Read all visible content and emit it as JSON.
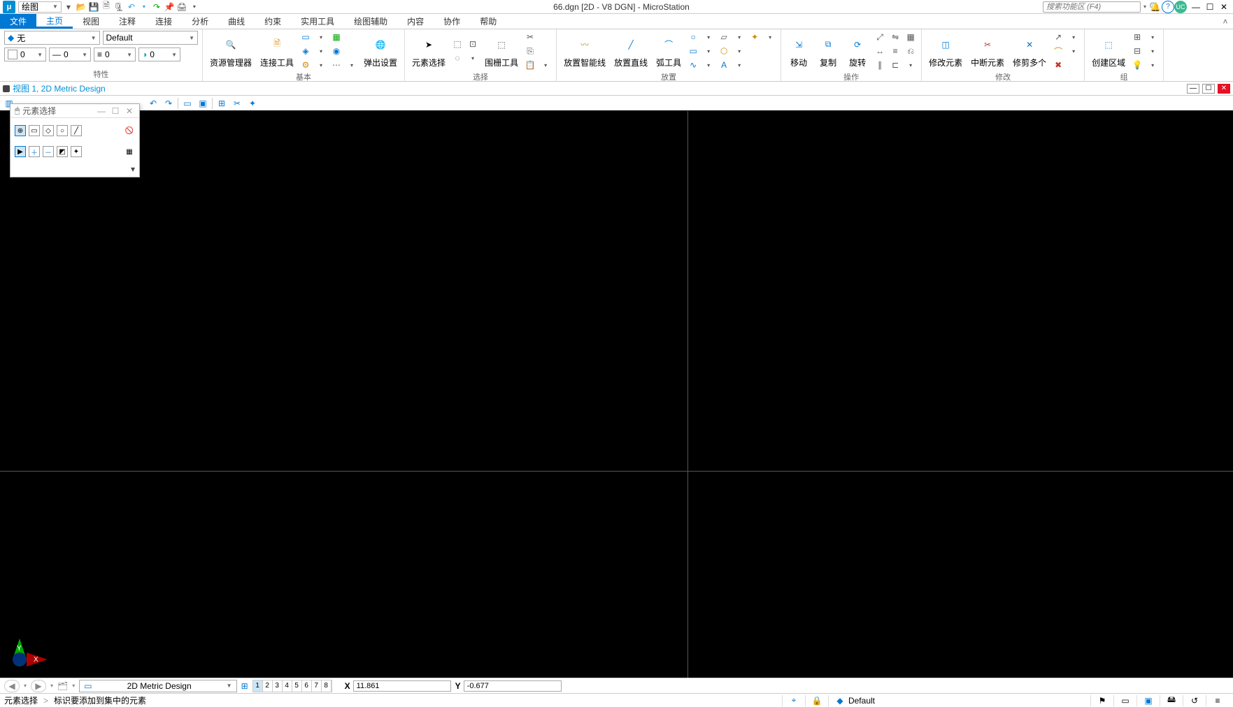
{
  "app": {
    "logo_text": "μ",
    "qat_workflow": "绘图",
    "title": "66.dgn [2D - V8 DGN] - MicroStation",
    "search_placeholder": "搜索功能区 (F4)",
    "user_initials": "UC"
  },
  "tabs": {
    "file": "文件",
    "items": [
      "主页",
      "视图",
      "注释",
      "连接",
      "分析",
      "曲线",
      "约束",
      "实用工具",
      "绘图辅助",
      "内容",
      "协作",
      "帮助"
    ],
    "active_index": 0
  },
  "ribbon": {
    "attributes": {
      "label": "特性",
      "level": "无",
      "template": "Default",
      "color_value": "0",
      "style_value": "0",
      "weight_value": "0",
      "class_value": "0"
    },
    "basic": {
      "label": "基本",
      "explorer": "资源管理器",
      "connect": "连接工具",
      "popup": "弹出设置"
    },
    "selection": {
      "label": "选择",
      "element_select": "元素选择",
      "fence": "围栅工具"
    },
    "place": {
      "label": "放置",
      "smartline": "放置智能线",
      "line": "放置直线",
      "arc": "弧工具"
    },
    "manipulate": {
      "label": "操作",
      "move": "移动",
      "copy": "复制",
      "rotate": "旋转"
    },
    "modify": {
      "label": "修改",
      "modify_element": "修改元素",
      "break_element": "中断元素",
      "trim_multi": "修剪多个"
    },
    "groups": {
      "label": "组",
      "create_region": "创建区域"
    }
  },
  "view": {
    "title": "视图 1, 2D Metric Design"
  },
  "float": {
    "title": "元素选择"
  },
  "status1": {
    "model": "2D Metric Design",
    "views": [
      "1",
      "2",
      "3",
      "4",
      "5",
      "6",
      "7",
      "8"
    ],
    "x_label": "X",
    "x_value": "11.861",
    "y_label": "Y",
    "y_value": "-0.677"
  },
  "status2": {
    "prompt_tool": "元素选择",
    "prompt_sep": ">",
    "prompt_msg": "标识要添加到集中的元素",
    "level": "Default"
  },
  "axis": {
    "x": "X",
    "y": "Y"
  }
}
